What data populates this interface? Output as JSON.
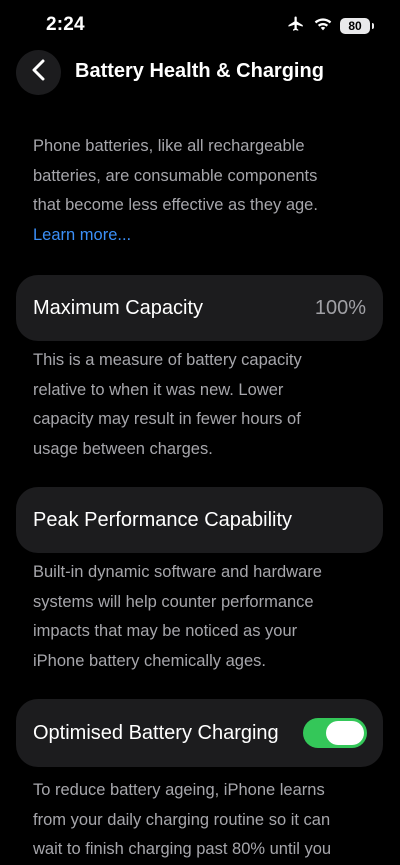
{
  "status_bar": {
    "time": "2:24",
    "battery_level": "80",
    "icons": [
      "airplane-icon",
      "wifi-icon",
      "battery-icon"
    ]
  },
  "nav": {
    "back_icon": "chevron-left-icon",
    "title": "Battery Health & Charging"
  },
  "intro": {
    "lines": [
      "Phone batteries, like all rechargeable",
      "batteries, are consumable components",
      "that become less effective as they age."
    ],
    "link_label": "Learn more..."
  },
  "max_capacity": {
    "label": "Maximum Capacity",
    "value": "100%",
    "description_lines": [
      "This is a measure of battery capacity",
      "relative to when it was new. Lower",
      "capacity may result in fewer hours of",
      "usage between charges."
    ]
  },
  "peak_performance": {
    "label": "Peak Performance Capability",
    "description_lines": [
      "Built-in dynamic software and hardware",
      "systems will help counter performance",
      "impacts that may be noticed as your",
      "iPhone battery chemically ages."
    ]
  },
  "optimised_charging": {
    "label": "Optimised Battery Charging",
    "enabled": true,
    "description_lines": [
      "To reduce battery ageing, iPhone learns",
      "from your daily charging routine so it can",
      "wait to finish charging past 80% until you"
    ]
  },
  "colors": {
    "background": "#000000",
    "card": "#1c1c1e",
    "secondary_text": "#a6a6ab",
    "link": "#3b8ff7",
    "toggle_on": "#34c759"
  }
}
